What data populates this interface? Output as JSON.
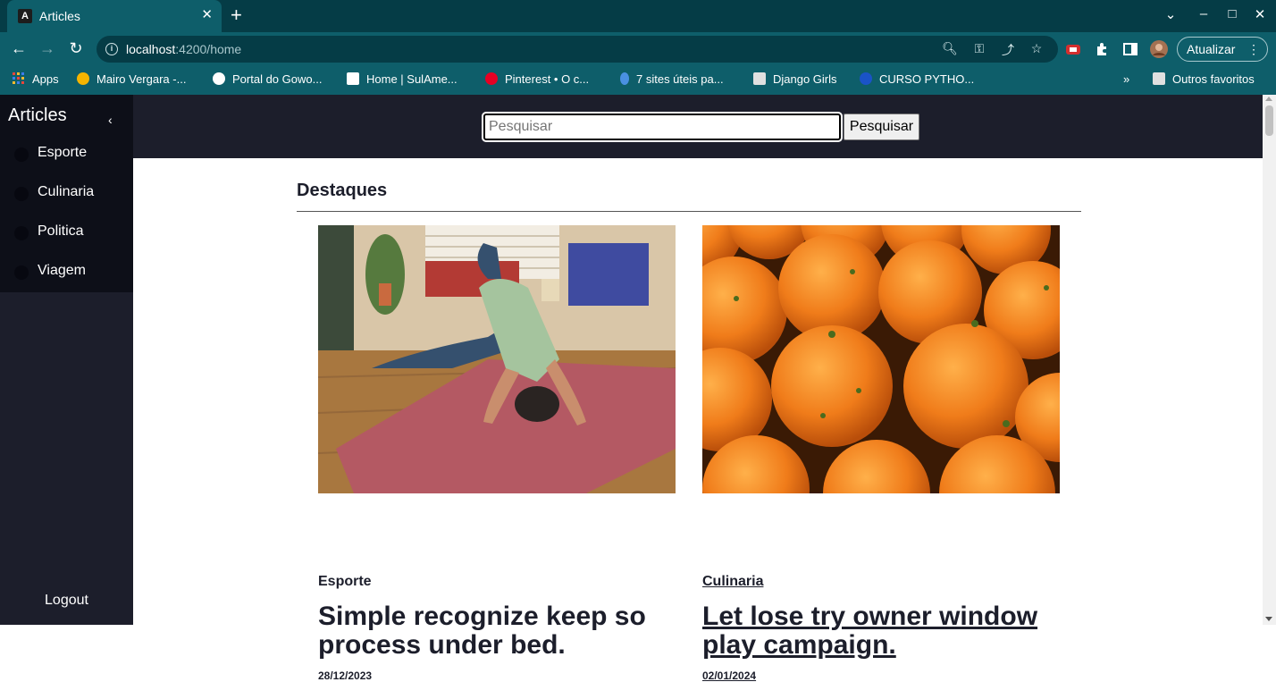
{
  "browser": {
    "tab_title": "Articles",
    "tab_favicon": "A",
    "url_host": "localhost",
    "url_path": ":4200/home",
    "update_label": "Atualizar",
    "bookmarks": [
      {
        "label": "Apps",
        "icon": "apps-grid-icon",
        "color": "#e8453c"
      },
      {
        "label": "Mairo Vergara -...",
        "icon": "site-icon",
        "color": "#f4b400"
      },
      {
        "label": "Portal do Gowo...",
        "icon": "globe-icon",
        "color": "#ffffff"
      },
      {
        "label": "Home | SulAme...",
        "icon": "sulamerica-icon",
        "color": "#ffffff"
      },
      {
        "label": "Pinterest • O c...",
        "icon": "pinterest-icon",
        "color": "#e60023"
      },
      {
        "label": "7 sites úteis pa...",
        "icon": "site-icon",
        "color": "#4a90e2"
      },
      {
        "label": "Django Girls",
        "icon": "folder-icon",
        "color": "#e0e0e0"
      },
      {
        "label": "CURSO PYTHO...",
        "icon": "site-icon",
        "color": "#1a53c7"
      }
    ],
    "other_bookmarks": "Outros favoritos"
  },
  "sidebar": {
    "title": "Articles",
    "items": [
      {
        "label": "Esporte"
      },
      {
        "label": "Culinaria"
      },
      {
        "label": "Politica"
      },
      {
        "label": "Viagem"
      }
    ],
    "logout": "Logout"
  },
  "search": {
    "placeholder": "Pesquisar",
    "button": "Pesquisar"
  },
  "main": {
    "section_title": "Destaques",
    "cards": [
      {
        "category": "Esporte",
        "title": "Simple recognize keep so process under bed.",
        "date": "28/12/2023",
        "image": "yoga-photo"
      },
      {
        "category": "Culinaria",
        "title": "Let lose try owner window play campaign.",
        "date": "02/01/2024",
        "image": "oranges-photo"
      }
    ]
  },
  "colors": {
    "browser_dark": "#053c46",
    "browser_teal": "#0e5e6a",
    "sidebar_bg": "#1c1e2b",
    "sidebar_top_bg": "#0d0f18"
  }
}
